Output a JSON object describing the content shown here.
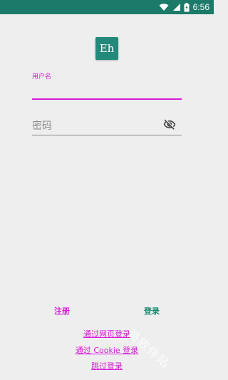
{
  "status_bar": {
    "time": "6:56",
    "icons": [
      "wifi-icon",
      "cell-signal-icon",
      "battery-icon"
    ]
  },
  "app": {
    "logo_text": "Eh"
  },
  "form": {
    "username_label": "用户名",
    "username_value": "",
    "password_placeholder": "密码",
    "password_value": ""
  },
  "actions": {
    "register_label": "注册",
    "login_label": "登录"
  },
  "links": {
    "web_login": "通过网页登录",
    "cookie_login": "通过 Cookie 登录",
    "skip_login": "跳过登录"
  },
  "watermark": "录软件站",
  "colors": {
    "status_bar": "#1b7a6a",
    "accent": "#d81bd8",
    "login": "#1b8a70",
    "background": "#eeeeee"
  }
}
